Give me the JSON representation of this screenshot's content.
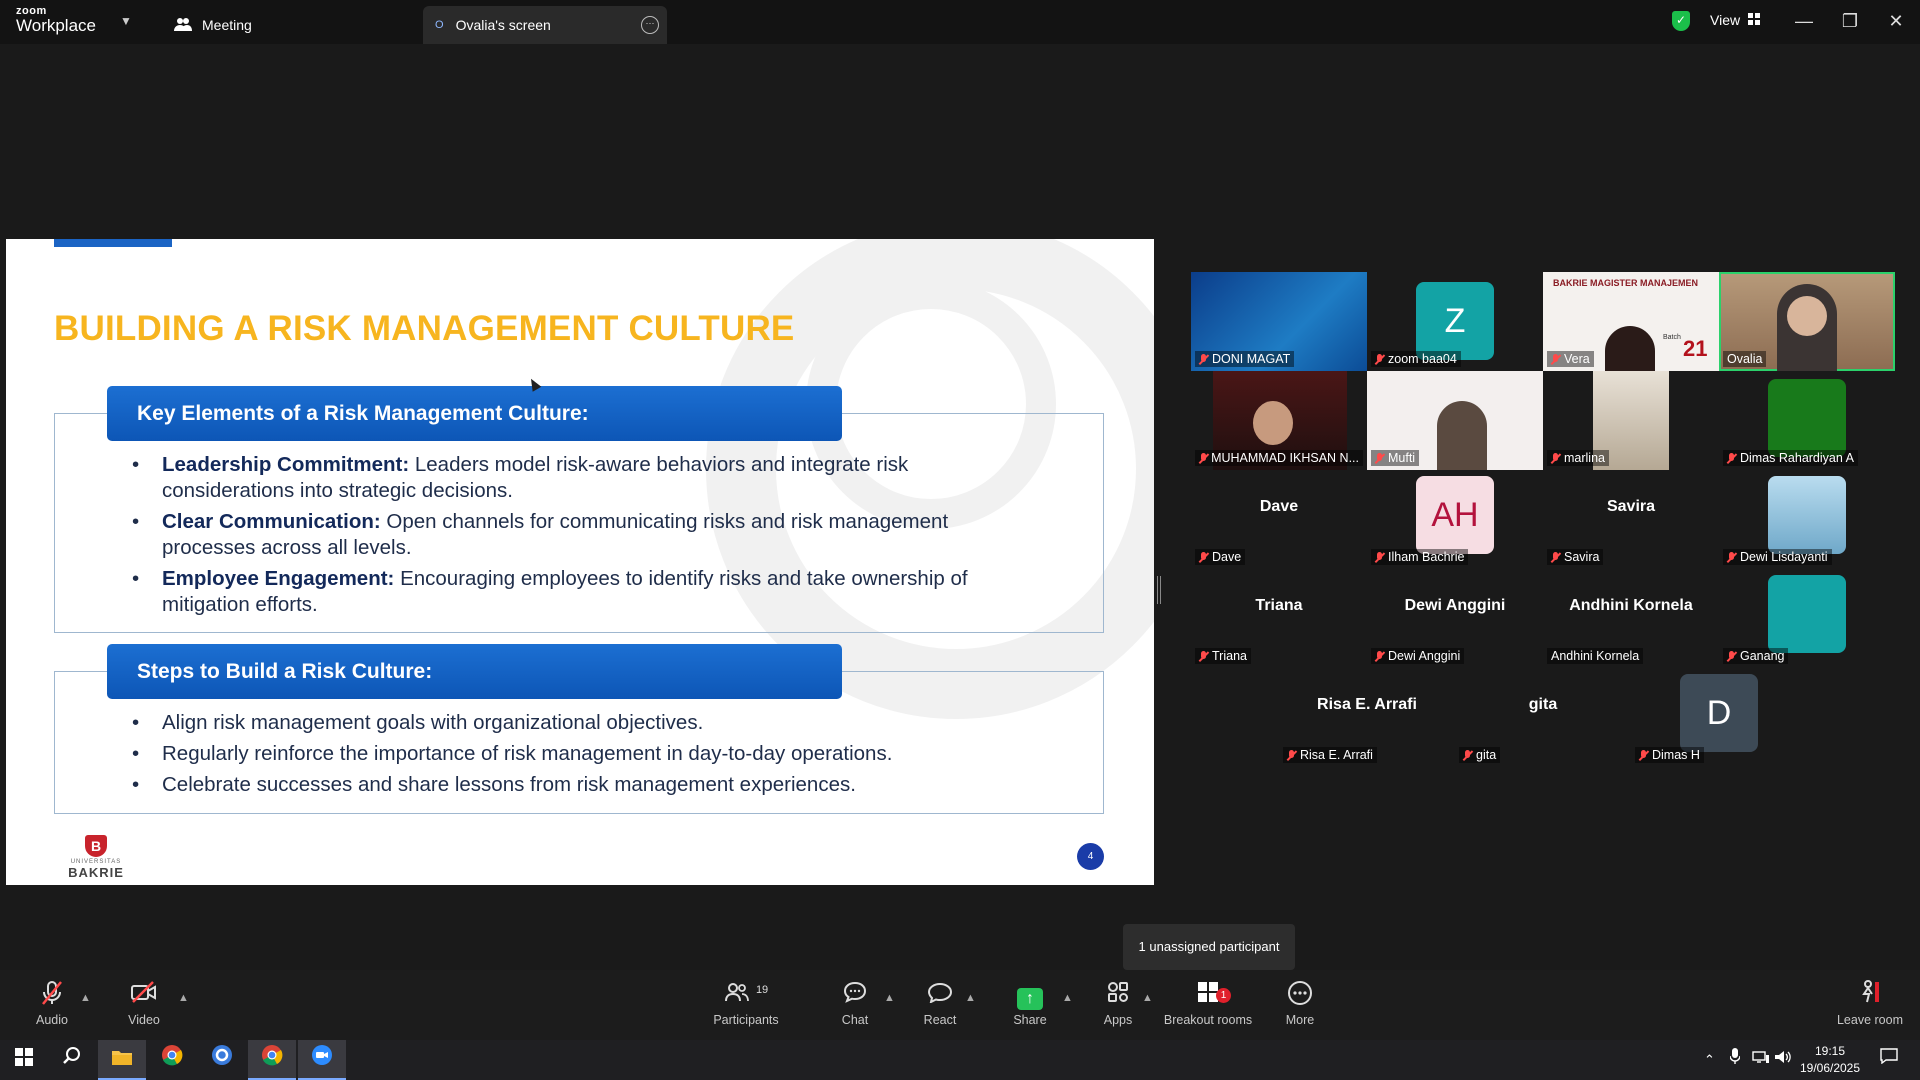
{
  "app": {
    "logo_line1": "zoom",
    "logo_line2": "Workplace"
  },
  "tabs": {
    "meeting": "Meeting",
    "screen": "Ovalia's screen",
    "screen_initial": "O"
  },
  "titlebar": {
    "view_label": "View"
  },
  "slide": {
    "title": "BUILDING A RISK MANAGEMENT CULTURE",
    "banner1": "Key Elements of a Risk Management Culture:",
    "items1": [
      {
        "bold": "Leadership Commitment:",
        "text": " Leaders model risk-aware behaviors and integrate risk considerations into strategic decisions."
      },
      {
        "bold": "Clear Communication:",
        "text": " Open channels for communicating risks and risk management processes across all levels."
      },
      {
        "bold": "Employee Engagement:",
        "text": " Encouraging employees to identify risks and take ownership of mitigation efforts."
      }
    ],
    "banner2": "Steps to Build a Risk Culture:",
    "items2": [
      "Align risk management goals with organizational objectives.",
      "Regularly reinforce the importance of risk management in day-to-day operations.",
      "Celebrate successes and share lessons from risk management experiences."
    ],
    "logo_sub": "UNIVERSITAS",
    "logo_main": "BAKRIE",
    "page_number": "4"
  },
  "participants": [
    {
      "name": "DONI MAGAT",
      "muted": true
    },
    {
      "name": "zoom baa04",
      "muted": true,
      "initial": "Z"
    },
    {
      "name": "Vera",
      "muted": true
    },
    {
      "name": "Ovalia",
      "muted": false
    },
    {
      "name": "MUHAMMAD IKHSAN N...",
      "muted": true
    },
    {
      "name": "Mufti",
      "muted": true
    },
    {
      "name": "marlina",
      "muted": true
    },
    {
      "name": "Dimas Rahardiyan A",
      "muted": true
    },
    {
      "name": "Dave",
      "muted": true,
      "big": "Dave"
    },
    {
      "name": "Ilham Bachrie",
      "muted": true,
      "initial": "AH"
    },
    {
      "name": "Savira",
      "muted": true,
      "big": "Savira"
    },
    {
      "name": "Dewi Lisdayanti",
      "muted": true
    },
    {
      "name": "Triana",
      "muted": true,
      "big": "Triana"
    },
    {
      "name": "Dewi Anggini",
      "muted": true,
      "big": "Dewi Anggini"
    },
    {
      "name": "Andhini Kornela",
      "muted": false,
      "big": "Andhini Kornela"
    },
    {
      "name": "Ganang",
      "muted": true
    },
    {
      "name": "Risa E. Arrafi",
      "muted": true,
      "big": "Risa E. Arrafi"
    },
    {
      "name": "gita",
      "muted": true,
      "big": "gita"
    },
    {
      "name": "Dimas H",
      "muted": true,
      "initial": "D"
    }
  ],
  "thumb_text": {
    "vera_brand": "BAKRIE MAGISTER MANAJEMEN",
    "vera_batch": "Batch",
    "vera_number": "21"
  },
  "tooltip": "1 unassigned participant",
  "toolbar": {
    "audio": "Audio",
    "video": "Video",
    "participants": "Participants",
    "participants_count": "19",
    "chat": "Chat",
    "react": "React",
    "share": "Share",
    "apps": "Apps",
    "breakout": "Breakout rooms",
    "breakout_badge": "1",
    "more": "More",
    "leave": "Leave room"
  },
  "taskbar": {
    "time": "19:15",
    "date": "19/06/2025"
  },
  "colors": {
    "slide_title": "#f7b51f",
    "banner": "#1565c8",
    "active_border": "#2bd16b",
    "share_green": "#26c25a"
  }
}
